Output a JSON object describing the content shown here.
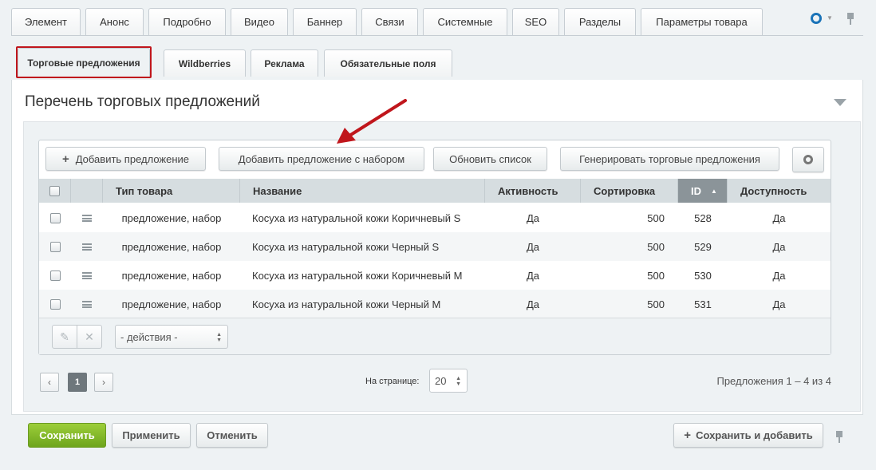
{
  "tabs_row1": [
    "Элемент",
    "Анонс",
    "Подробно",
    "Видео",
    "Баннер",
    "Связи",
    "Системные",
    "SEO",
    "Разделы",
    "Параметры товара"
  ],
  "tabs_row2": [
    "Торговые предложения",
    "Wildberries",
    "Реклама",
    "Обязательные поля"
  ],
  "panel": {
    "title": "Перечень торговых предложений"
  },
  "toolbar": {
    "add_offer": "Добавить предложение",
    "add_offer_set": "Добавить предложение с набором",
    "refresh": "Обновить список",
    "generate": "Генерировать торговые предложения"
  },
  "table": {
    "columns": [
      "Тип товара",
      "Название",
      "Активность",
      "Сортировка",
      "ID",
      "Доступность"
    ],
    "sort_indicator": "▲",
    "rows": [
      {
        "type": "предложение, набор",
        "name": "Косуха из натуральной кожи Коричневый S",
        "active": "Да",
        "sort": "500",
        "id": "528",
        "available": "Да"
      },
      {
        "type": "предложение, набор",
        "name": "Косуха из натуральной кожи Черный S",
        "active": "Да",
        "sort": "500",
        "id": "529",
        "available": "Да"
      },
      {
        "type": "предложение, набор",
        "name": "Косуха из натуральной кожи Коричневый M",
        "active": "Да",
        "sort": "500",
        "id": "530",
        "available": "Да"
      },
      {
        "type": "предложение, набор",
        "name": "Косуха из натуральной кожи Черный M",
        "active": "Да",
        "sort": "500",
        "id": "531",
        "available": "Да"
      }
    ]
  },
  "grid_footer": {
    "actions_select": "- действия -"
  },
  "pagination": {
    "prev": "‹",
    "current_page": "1",
    "next": "›",
    "per_page_label": "На странице:",
    "per_page_value": "20",
    "summary": "Предложения 1 – 4 из 4"
  },
  "bottom": {
    "save": "Сохранить",
    "apply": "Применить",
    "cancel": "Отменить",
    "save_add": "Сохранить и добавить"
  },
  "colors": {
    "highlight_red": "#c0161c",
    "save_green": "#7cb526",
    "settings_blue": "#1a73b8"
  }
}
